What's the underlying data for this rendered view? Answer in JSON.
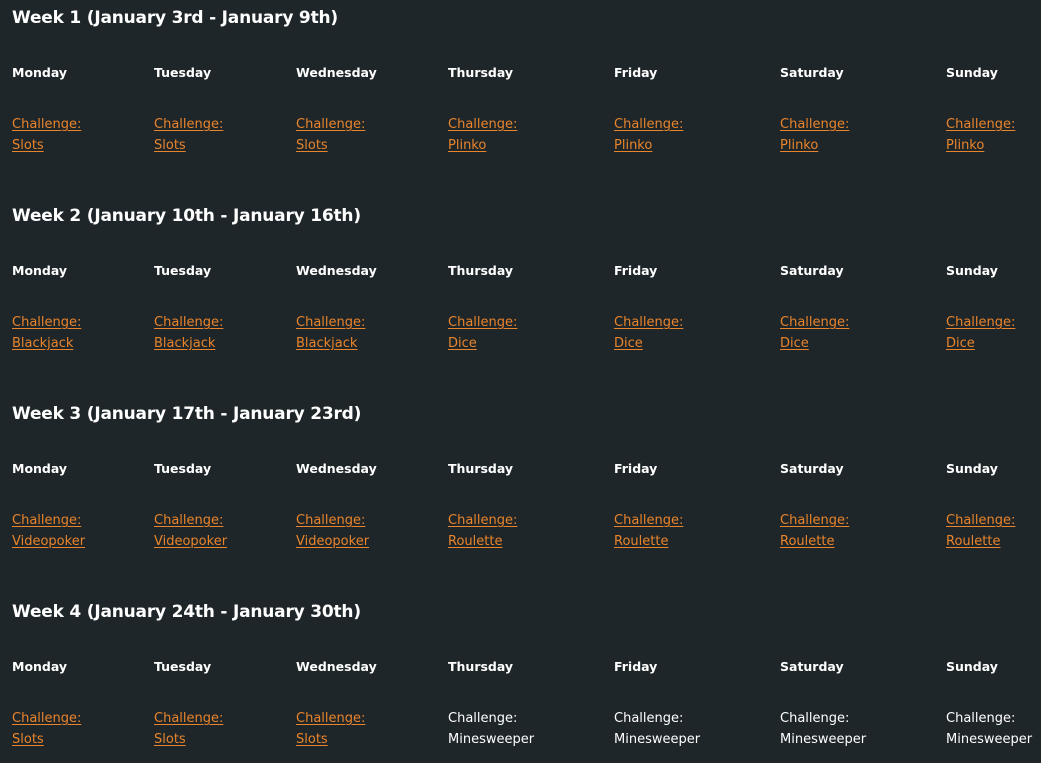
{
  "weeks": [
    {
      "title": "Week 1 (January 3rd - January 9th)",
      "days": [
        {
          "day": "Monday",
          "label": "Challenge:",
          "game": "Slots",
          "linked": true
        },
        {
          "day": "Tuesday",
          "label": "Challenge:",
          "game": "Slots",
          "linked": true
        },
        {
          "day": "Wednesday",
          "label": "Challenge:",
          "game": "Slots",
          "linked": true
        },
        {
          "day": "Thursday",
          "label": "Challenge:",
          "game": "Plinko",
          "linked": true
        },
        {
          "day": "Friday",
          "label": "Challenge:",
          "game": "Plinko",
          "linked": true
        },
        {
          "day": "Saturday",
          "label": "Challenge:",
          "game": "Plinko",
          "linked": true
        },
        {
          "day": "Sunday",
          "label": "Challenge:",
          "game": "Plinko",
          "linked": true
        }
      ]
    },
    {
      "title": "Week 2 (January 10th - January 16th)",
      "days": [
        {
          "day": "Monday",
          "label": "Challenge:",
          "game": "Blackjack",
          "linked": true
        },
        {
          "day": "Tuesday",
          "label": "Challenge:",
          "game": "Blackjack",
          "linked": true
        },
        {
          "day": "Wednesday",
          "label": "Challenge:",
          "game": "Blackjack",
          "linked": true
        },
        {
          "day": "Thursday",
          "label": "Challenge:",
          "game": "Dice",
          "linked": true
        },
        {
          "day": "Friday",
          "label": "Challenge:",
          "game": "Dice",
          "linked": true
        },
        {
          "day": "Saturday",
          "label": "Challenge:",
          "game": "Dice",
          "linked": true
        },
        {
          "day": "Sunday",
          "label": "Challenge:",
          "game": "Dice",
          "linked": true
        }
      ]
    },
    {
      "title": "Week 3 (January 17th - January 23rd)",
      "days": [
        {
          "day": "Monday",
          "label": "Challenge:",
          "game": "Videopoker",
          "linked": true
        },
        {
          "day": "Tuesday",
          "label": "Challenge:",
          "game": "Videopoker",
          "linked": true
        },
        {
          "day": "Wednesday",
          "label": "Challenge:",
          "game": "Videopoker",
          "linked": true
        },
        {
          "day": "Thursday",
          "label": "Challenge:",
          "game": "Roulette",
          "linked": true
        },
        {
          "day": "Friday",
          "label": "Challenge:",
          "game": "Roulette",
          "linked": true
        },
        {
          "day": "Saturday",
          "label": "Challenge:",
          "game": "Roulette",
          "linked": true
        },
        {
          "day": "Sunday",
          "label": "Challenge:",
          "game": "Roulette",
          "linked": true
        }
      ]
    },
    {
      "title": "Week 4 (January 24th - January 30th)",
      "days": [
        {
          "day": "Monday",
          "label": "Challenge:",
          "game": "Slots",
          "linked": true
        },
        {
          "day": "Tuesday",
          "label": "Challenge:",
          "game": "Slots",
          "linked": true
        },
        {
          "day": "Wednesday",
          "label": "Challenge:",
          "game": "Slots",
          "linked": true
        },
        {
          "day": "Thursday",
          "label": "Challenge:",
          "game": "Minesweeper",
          "linked": false
        },
        {
          "day": "Friday",
          "label": "Challenge:",
          "game": "Minesweeper",
          "linked": false
        },
        {
          "day": "Saturday",
          "label": "Challenge:",
          "game": "Minesweeper",
          "linked": false
        },
        {
          "day": "Sunday",
          "label": "Challenge:",
          "game": "Minesweeper",
          "linked": false
        }
      ]
    }
  ],
  "colors": {
    "background": "#1f2629",
    "link": "#e8842c",
    "text": "#ffffff"
  }
}
